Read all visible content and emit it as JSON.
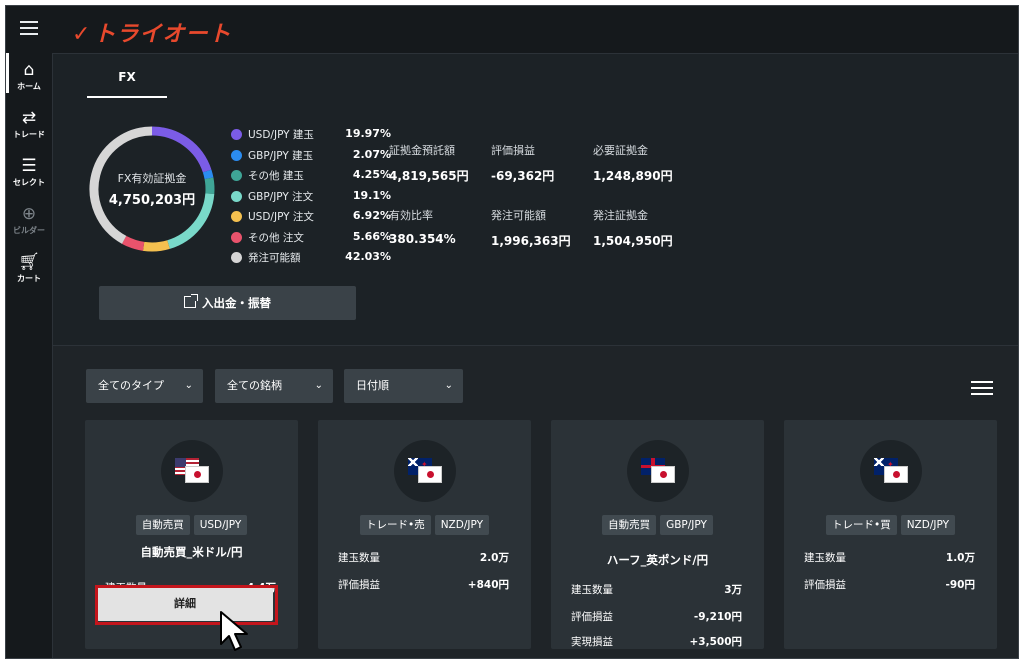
{
  "app": {
    "logo_text": "トライオート",
    "brand_color": "#e8492d"
  },
  "sidebar": {
    "items": [
      {
        "label": "ホーム",
        "icon": "home-icon",
        "active": true
      },
      {
        "label": "トレード",
        "icon": "trade-arrows-icon",
        "active": false
      },
      {
        "label": "セレクト",
        "icon": "select-icon",
        "active": false
      },
      {
        "label": "ビルダー",
        "icon": "plus-circle-icon",
        "active": false
      },
      {
        "label": "カート",
        "icon": "cart-icon",
        "active": false
      }
    ]
  },
  "fx_panel": {
    "tab_label": "FX",
    "donut": {
      "label": "FX有効証拠金",
      "value": "4,750,203円",
      "segments": [
        {
          "name": "USD/JPY 建玉",
          "pct": "19.97%",
          "value": 19.97,
          "color": "#7b5ce6"
        },
        {
          "name": "GBP/JPY 建玉",
          "pct": "2.07%",
          "value": 2.07,
          "color": "#2b8cf0"
        },
        {
          "name": "その他 建玉",
          "pct": "4.25%",
          "value": 4.25,
          "color": "#3fa596"
        },
        {
          "name": "GBP/JPY 注文",
          "pct": "19.1%",
          "value": 19.1,
          "color": "#79d9c9"
        },
        {
          "name": "USD/JPY 注文",
          "pct": "6.92%",
          "value": 6.92,
          "color": "#f4c04f"
        },
        {
          "name": "その他 注文",
          "pct": "5.66%",
          "value": 5.66,
          "color": "#e9536c"
        },
        {
          "name": "発注可能額",
          "pct": "42.03%",
          "value": 42.03,
          "color": "#d6d6d6"
        }
      ]
    },
    "stats": [
      {
        "label": "証拠金預託額",
        "value": "4,819,565円"
      },
      {
        "label": "評価損益",
        "value": "-69,362円"
      },
      {
        "label": "必要証拠金",
        "value": "1,248,890円"
      },
      {
        "label": "有効比率",
        "value": "380.354%"
      },
      {
        "label": "発注可能額",
        "value": "1,996,363円"
      },
      {
        "label": "発注証拠金",
        "value": "1,504,950円"
      }
    ],
    "deposit_button": "入出金・振替"
  },
  "filters": {
    "type": "全てのタイプ",
    "symbol": "全ての銘柄",
    "sort": "日付順"
  },
  "cards": [
    {
      "tags": [
        "自動売買",
        "USD/JPY"
      ],
      "title": "自動売買_米ドル/円",
      "rows": [
        {
          "k": "建玉数量",
          "v": "4.4万"
        }
      ],
      "detail_button": "詳細"
    },
    {
      "tags": [
        "トレード•売",
        "NZD/JPY"
      ],
      "title": "",
      "rows": [
        {
          "k": "建玉数量",
          "v": "2.0万"
        },
        {
          "k": "評価損益",
          "v": "+840円"
        }
      ]
    },
    {
      "tags": [
        "自動売買",
        "GBP/JPY"
      ],
      "title": "ハーフ_英ポンド/円",
      "rows": [
        {
          "k": "建玉数量",
          "v": "3万"
        },
        {
          "k": "評価損益",
          "v": "-9,210円"
        },
        {
          "k": "実現損益",
          "v": "+3,500円"
        }
      ]
    },
    {
      "tags": [
        "トレード•買",
        "NZD/JPY"
      ],
      "title": "",
      "rows": [
        {
          "k": "建玉数量",
          "v": "1.0万"
        },
        {
          "k": "評価損益",
          "v": "-90円"
        }
      ]
    }
  ]
}
